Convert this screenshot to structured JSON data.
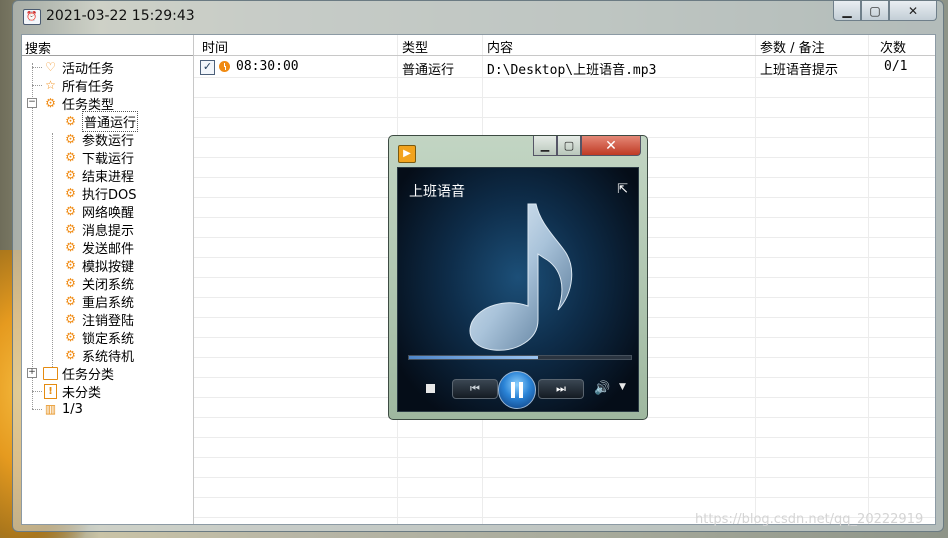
{
  "window": {
    "title": "2021-03-22 15:29:43",
    "app_icon": "task-app-icon"
  },
  "caption": {
    "minimize": "▁",
    "maximize": "▢",
    "close": "✕"
  },
  "sidebar": {
    "search_label": "搜索",
    "items": [
      {
        "label": "活动任务",
        "icon": "heart-icon"
      },
      {
        "label": "所有任务",
        "icon": "star-icon"
      },
      {
        "label": "任务类型",
        "icon": "gear-icon"
      },
      {
        "label": "普通运行",
        "icon": "gear-icon"
      },
      {
        "label": "参数运行",
        "icon": "gear-icon"
      },
      {
        "label": "下载运行",
        "icon": "gear-icon"
      },
      {
        "label": "结束进程",
        "icon": "gear-icon"
      },
      {
        "label": "执行DOS",
        "icon": "gear-icon"
      },
      {
        "label": "网络唤醒",
        "icon": "gear-icon"
      },
      {
        "label": "消息提示",
        "icon": "gear-icon"
      },
      {
        "label": "发送邮件",
        "icon": "gear-icon"
      },
      {
        "label": "模拟按键",
        "icon": "gear-icon"
      },
      {
        "label": "关闭系统",
        "icon": "gear-icon"
      },
      {
        "label": "重启系统",
        "icon": "gear-icon"
      },
      {
        "label": "注销登陆",
        "icon": "gear-icon"
      },
      {
        "label": "锁定系统",
        "icon": "gear-icon"
      },
      {
        "label": "系统待机",
        "icon": "gear-icon"
      },
      {
        "label": "任务分类",
        "icon": "folder-icon"
      },
      {
        "label": "未分类",
        "icon": "exclamation-icon"
      },
      {
        "label": "1/3",
        "icon": "bar-chart-icon"
      }
    ]
  },
  "table": {
    "columns": [
      "时间",
      "类型",
      "内容",
      "参数 / 备注",
      "次数"
    ],
    "rows": [
      {
        "checked": true,
        "time": "08:30:00",
        "type": "普通运行",
        "content": "D:\\Desktop\\上班语音.mp3",
        "note": "上班语音提示",
        "count": "0/1"
      }
    ]
  },
  "player": {
    "track_title": "上班语音",
    "progress": 0.58,
    "colors": {
      "accent": "#2a83d6",
      "close": "#c03a24"
    }
  },
  "watermark": "https://blog.csdn.net/qq_20222919"
}
